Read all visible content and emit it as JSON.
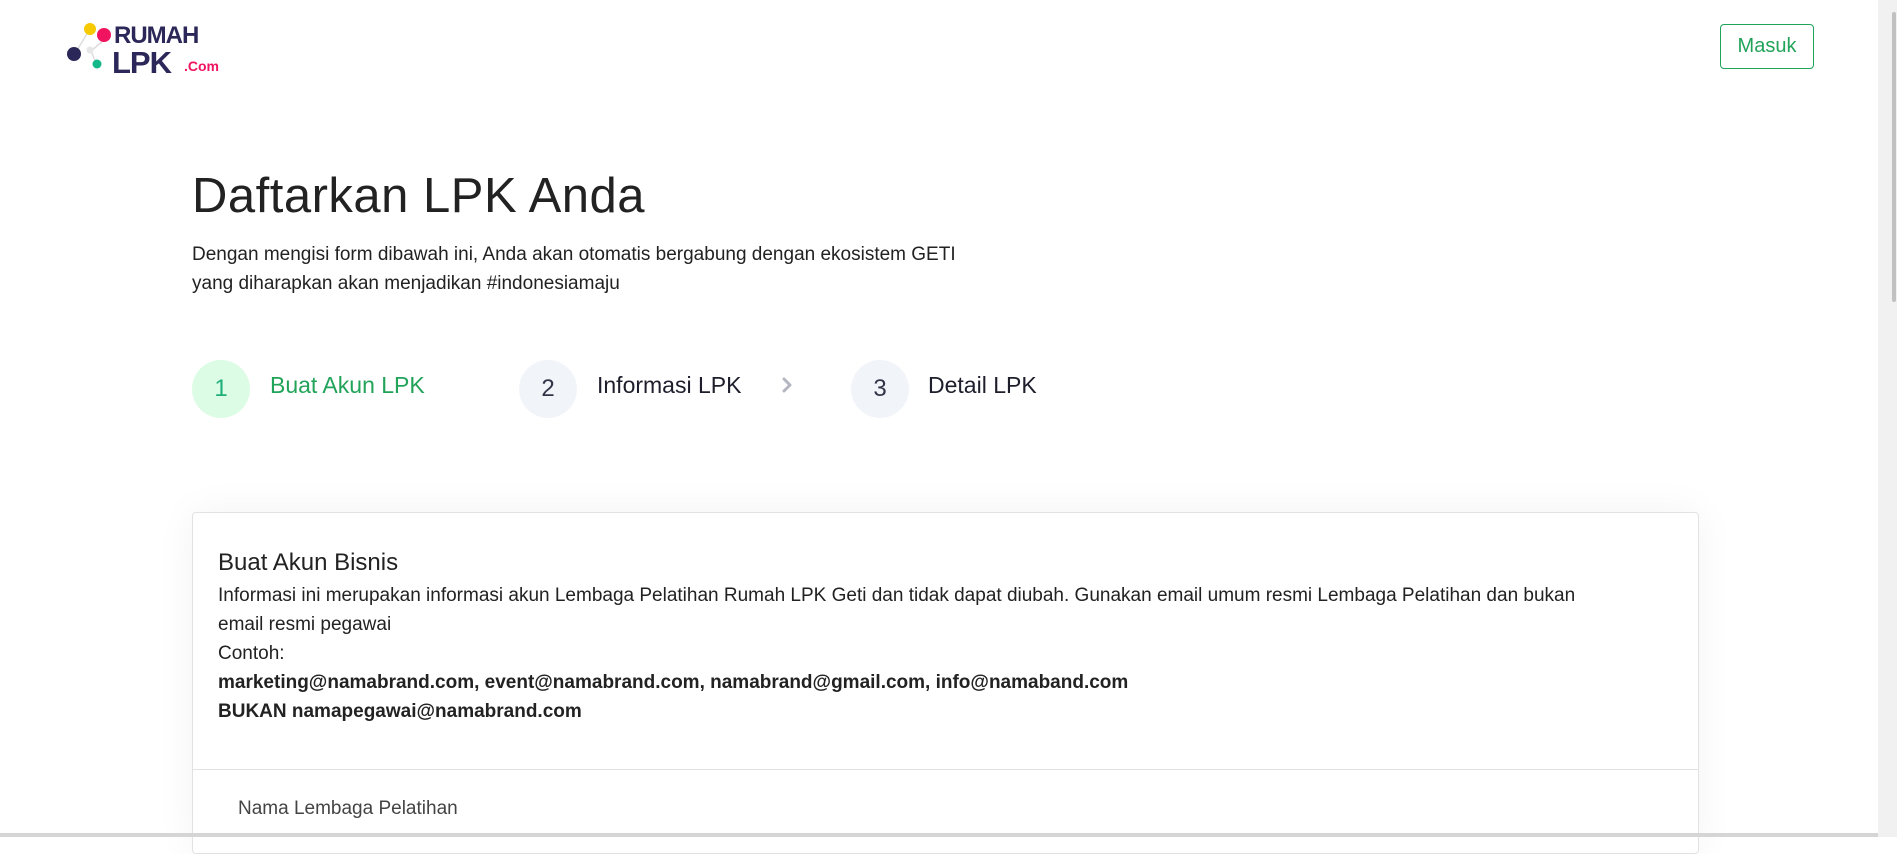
{
  "header": {
    "logo_text_top": "RUMAH",
    "logo_text_bottom": "LPK",
    "logo_suffix": ".Com",
    "login_button": "Masuk"
  },
  "page": {
    "title": "Daftarkan LPK Anda",
    "subtitle_line1": "Dengan mengisi form dibawah ini, Anda akan otomatis bergabung dengan ekosistem GETI",
    "subtitle_line2": "yang diharapkan akan menjadikan #indonesiamaju"
  },
  "steps": [
    {
      "number": "1",
      "label": "Buat Akun LPK",
      "active": true
    },
    {
      "number": "2",
      "label": "Informasi LPK",
      "active": false
    },
    {
      "number": "3",
      "label": "Detail LPK",
      "active": false
    }
  ],
  "card": {
    "title": "Buat Akun Bisnis",
    "description": "Informasi ini merupakan informasi akun Lembaga Pelatihan Rumah LPK Geti dan tidak dapat diubah. Gunakan email umum resmi Lembaga Pelatihan dan bukan email resmi pegawai",
    "example_label": "Contoh:",
    "example_emails": "marketing@namabrand.com, event@namabrand.com, namabrand@gmail.com, info@namaband.com",
    "not_example": "BUKAN namapegawai@namabrand.com",
    "field_label": "Nama Lembaga Pelatihan"
  },
  "colors": {
    "accent_green": "#22a35a",
    "logo_navy": "#2b2758",
    "logo_pink": "#f0135f",
    "logo_yellow": "#f7c900",
    "logo_teal": "#13b88a"
  }
}
